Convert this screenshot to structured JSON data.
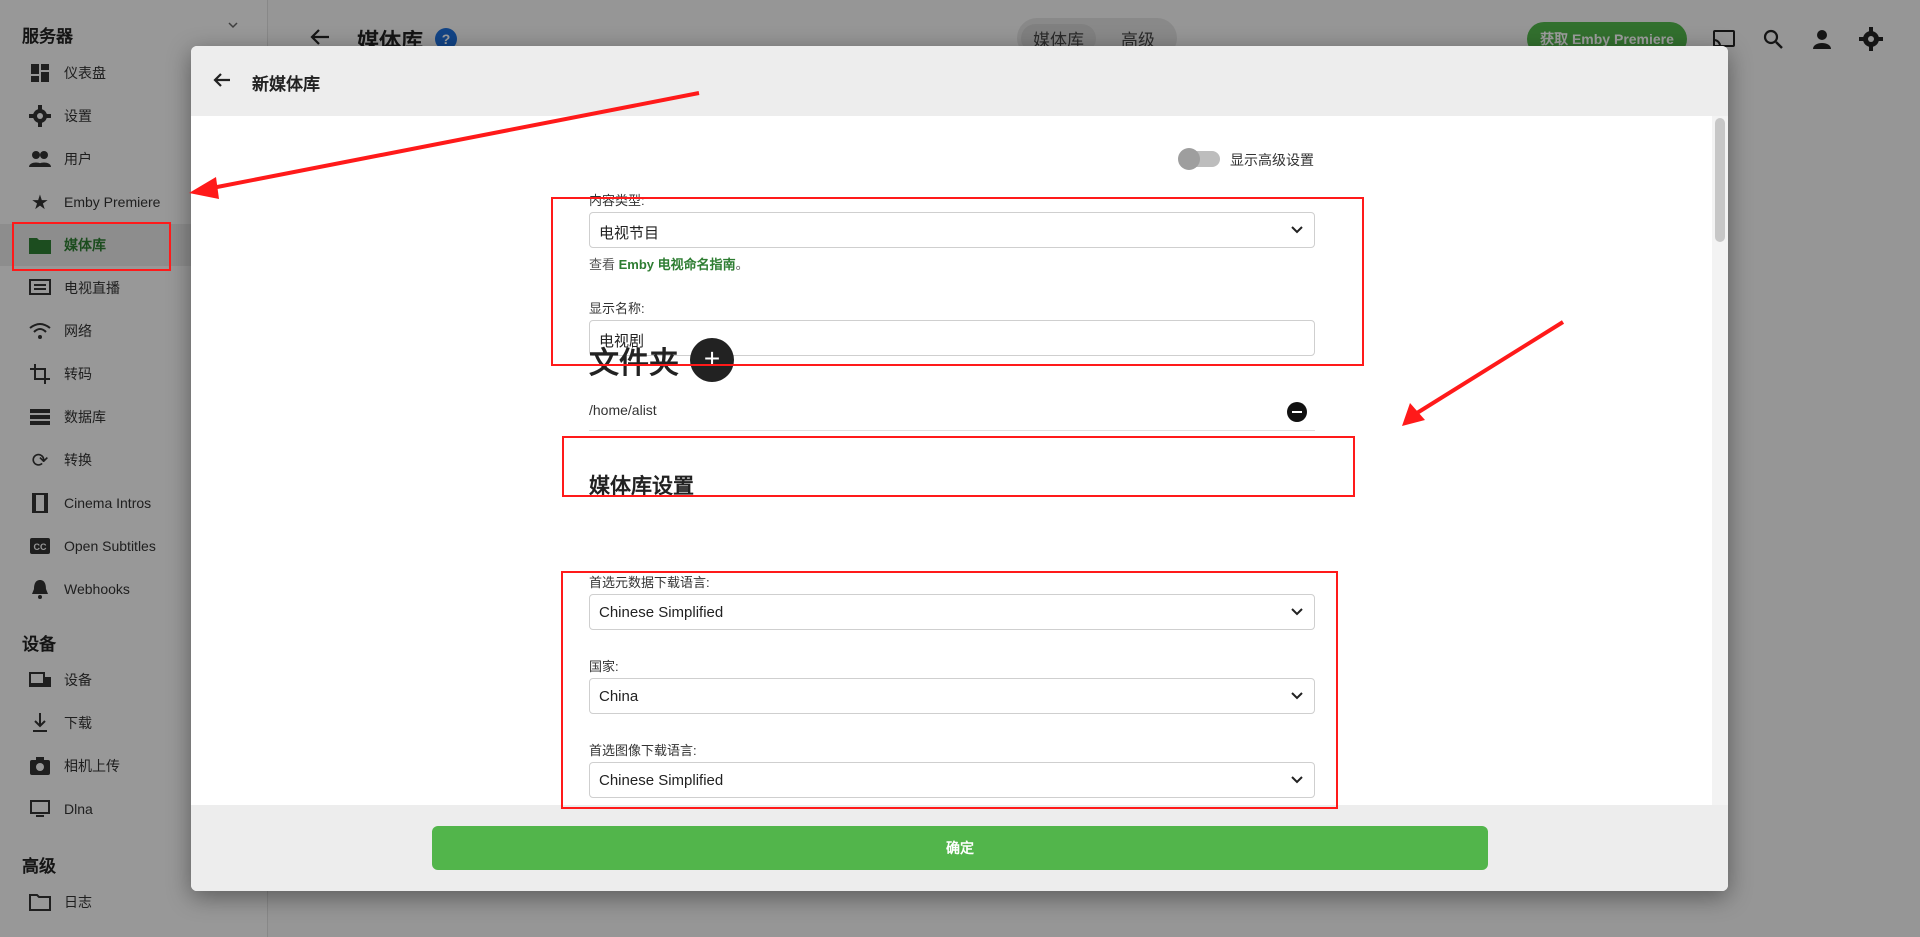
{
  "sidebar": {
    "section_server": "服务器",
    "section_devices": "设备",
    "section_advanced": "高级",
    "items": [
      {
        "label": "仪表盘",
        "icon": "dashboard-icon"
      },
      {
        "label": "设置",
        "icon": "gear-icon"
      },
      {
        "label": "用户",
        "icon": "users-icon"
      },
      {
        "label": "Emby Premiere",
        "icon": "star-icon"
      },
      {
        "label": "媒体库",
        "icon": "folder-icon",
        "active": true
      },
      {
        "label": "电视直播",
        "icon": "tv-guide-icon"
      },
      {
        "label": "网络",
        "icon": "wifi-icon"
      },
      {
        "label": "转码",
        "icon": "crop-icon"
      },
      {
        "label": "数据库",
        "icon": "database-icon"
      },
      {
        "label": "转换",
        "icon": "sync-icon"
      },
      {
        "label": "Cinema Intros",
        "icon": "film-icon"
      },
      {
        "label": "Open Subtitles",
        "icon": "cc-icon"
      },
      {
        "label": "Webhooks",
        "icon": "bell-icon"
      },
      {
        "label": "设备",
        "icon": "devices-icon"
      },
      {
        "label": "下载",
        "icon": "download-icon"
      },
      {
        "label": "相机上传",
        "icon": "camera-icon"
      },
      {
        "label": "Dlna",
        "icon": "dlna-icon"
      },
      {
        "label": "日志",
        "icon": "folder-outline-icon"
      }
    ]
  },
  "topbar": {
    "title": "媒体库",
    "help": "?",
    "tabs": [
      "媒体库",
      "高级"
    ],
    "premiere_button": "获取 Emby Premiere"
  },
  "dialog": {
    "title": "新媒体库",
    "advanced_toggle_label": "显示高级设置",
    "content_type_label": "内容类型:",
    "content_type_value": "电视节目",
    "hint_prefix": "查看 ",
    "hint_link": "Emby 电视命名指南",
    "hint_suffix": "。",
    "display_name_label": "显示名称:",
    "display_name_value": "电视剧",
    "folders_heading": "文件夹",
    "add_folder": "+",
    "folders": [
      "/home/alist"
    ],
    "library_settings_heading": "媒体库设置",
    "metadata_lang_label": "首选元数据下载语言:",
    "metadata_lang_value": "Chinese Simplified",
    "country_label": "国家:",
    "country_value": "China",
    "image_lang_label": "首选图像下载语言:",
    "image_lang_value": "Chinese Simplified",
    "confirm_button": "确定"
  },
  "colors": {
    "accent_green": "#52b54b",
    "annotation_red": "#ff1a1a"
  }
}
